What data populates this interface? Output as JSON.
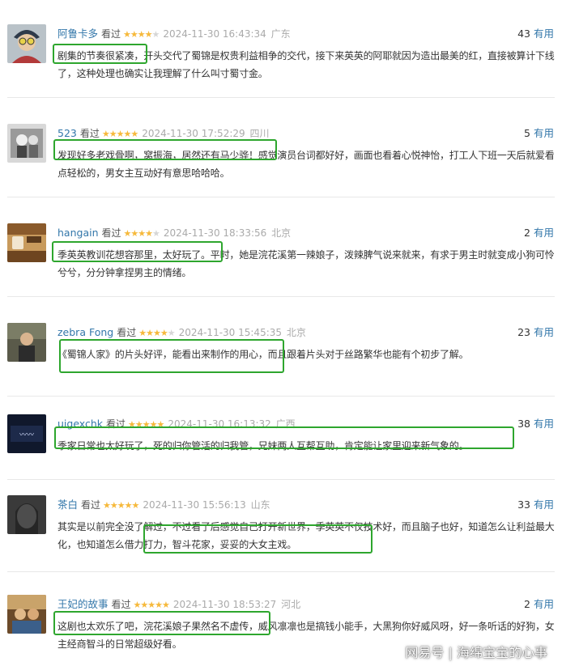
{
  "colors": {
    "highlight": "#2ea62e",
    "username": "#3377aa",
    "star": "#f6b93b"
  },
  "reviews": [
    {
      "user": "阿鲁卡多",
      "watched": "看过",
      "stars": 4,
      "time": "2024-11-30 16:43:34",
      "location": "广东",
      "votes": "43",
      "useful": "有用",
      "text": "剧集的节奏很紧凑，开头交代了蜀锦是权贵利益相争的交代，接下来英英的阿耶就因为造出最美的红，直接被算计下线了，这种处理也确实让我理解了什么叫寸蜀寸金。"
    },
    {
      "user": "523",
      "watched": "看过",
      "stars": 5,
      "time": "2024-11-30 17:52:29",
      "location": "四川",
      "votes": "5",
      "useful": "有用",
      "text": "发现好多老戏骨啊，窝振海，居然还有马少骅！感觉演员台词都好好，画面也看着心悦神怡，打工人下班一天后就爱看点轻松的，男女主互动好有意思哈哈哈。"
    },
    {
      "user": "hangain",
      "watched": "看过",
      "stars": 4,
      "time": "2024-11-30 18:33:56",
      "location": "北京",
      "votes": "2",
      "useful": "有用",
      "text": "季英英教训花想容那里，太好玩了。平时，她是浣花溪第一辣娘子，泼辣脾气说来就来，有求于男主时就变成小狗可怜兮兮，分分钟拿捏男主的情绪。"
    },
    {
      "user": "zebra Fong",
      "watched": "看过",
      "stars": 4,
      "time": "2024-11-30 15:45:35",
      "location": "北京",
      "votes": "23",
      "useful": "有用",
      "text": "《蜀锦人家》的片头好评，能看出来制作的用心，而且跟着片头对于丝路繁华也能有个初步了解。"
    },
    {
      "user": "uigexchk",
      "watched": "看过",
      "stars": 5,
      "time": "2024-11-30 16:13:32",
      "location": "广西",
      "votes": "38",
      "useful": "有用",
      "text": "季家日常也太好玩了，死的归你管活的归我管，兄妹两人互帮互助，肯定能让家里迎来新气象的。"
    },
    {
      "user": "茶白",
      "watched": "看过",
      "stars": 5,
      "time": "2024-11-30 15:56:13",
      "location": "山东",
      "votes": "33",
      "useful": "有用",
      "text": "其实是以前完全没了解过，不过看了后感觉自己打开新世界，季英英不仅技术好，而且脑子也好，知道怎么让利益最大化，也知道怎么借力打力，智斗花家，妥妥的大女主戏。"
    },
    {
      "user": "王妃的故事",
      "watched": "看过",
      "stars": 5,
      "time": "2024-11-30 18:53:27",
      "location": "河北",
      "votes": "2",
      "useful": "有用",
      "text": "这剧也太欢乐了吧，浣花溪娘子果然名不虚传，威风凛凛也是搞钱小能手，大黑狗你好威风呀，好一条听话的好狗，女主经商智斗的日常超级好看。"
    }
  ],
  "watermark": "网易号 | 海绵宝宝的心事"
}
